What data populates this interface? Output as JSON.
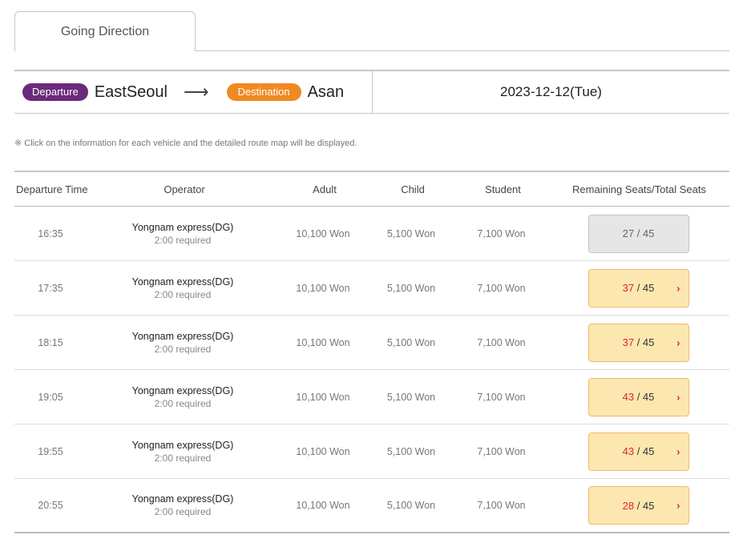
{
  "tab": {
    "label": "Going Direction"
  },
  "route": {
    "departure_label": "Departure",
    "departure_city": "EastSeoul",
    "destination_label": "Destination",
    "destination_city": "Asan",
    "date": "2023-12-12(Tue)"
  },
  "notice": "※ Click on the information for each vehicle and the detailed route map will be displayed.",
  "table": {
    "headers": {
      "time": "Departure Time",
      "operator": "Operator",
      "adult": "Adult",
      "child": "Child",
      "student": "Student",
      "seats": "Remaining Seats/Total Seats"
    },
    "rows": [
      {
        "time": "16:35",
        "operator": "Yongnam express(DG)",
        "duration": "2:00 required",
        "adult": "10,100 Won",
        "child": "5,100 Won",
        "student": "7,100 Won",
        "remaining": "27",
        "sep": " / ",
        "total": "45",
        "state": "full"
      },
      {
        "time": "17:35",
        "operator": "Yongnam express(DG)",
        "duration": "2:00 required",
        "adult": "10,100 Won",
        "child": "5,100 Won",
        "student": "7,100 Won",
        "remaining": "37",
        "sep": " / ",
        "total": "45",
        "state": "open"
      },
      {
        "time": "18:15",
        "operator": "Yongnam express(DG)",
        "duration": "2:00 required",
        "adult": "10,100 Won",
        "child": "5,100 Won",
        "student": "7,100 Won",
        "remaining": "37",
        "sep": " / ",
        "total": "45",
        "state": "open"
      },
      {
        "time": "19:05",
        "operator": "Yongnam express(DG)",
        "duration": "2:00 required",
        "adult": "10,100 Won",
        "child": "5,100 Won",
        "student": "7,100 Won",
        "remaining": "43",
        "sep": " / ",
        "total": "45",
        "state": "open"
      },
      {
        "time": "19:55",
        "operator": "Yongnam express(DG)",
        "duration": "2:00 required",
        "adult": "10,100 Won",
        "child": "5,100 Won",
        "student": "7,100 Won",
        "remaining": "43",
        "sep": " / ",
        "total": "45",
        "state": "open"
      },
      {
        "time": "20:55",
        "operator": "Yongnam express(DG)",
        "duration": "2:00 required",
        "adult": "10,100 Won",
        "child": "5,100 Won",
        "student": "7,100 Won",
        "remaining": "28",
        "sep": " / ",
        "total": "45",
        "state": "open"
      }
    ]
  },
  "icons": {
    "arrow": "right-arrow-icon",
    "chevron": "chevron-right-icon"
  },
  "colors": {
    "departure_pill": "#6b2a7a",
    "destination_pill": "#f08a24",
    "seat_open_bg": "#fde7b0",
    "seat_full_bg": "#e6e6e6",
    "remaining_accent": "#e0262b"
  }
}
